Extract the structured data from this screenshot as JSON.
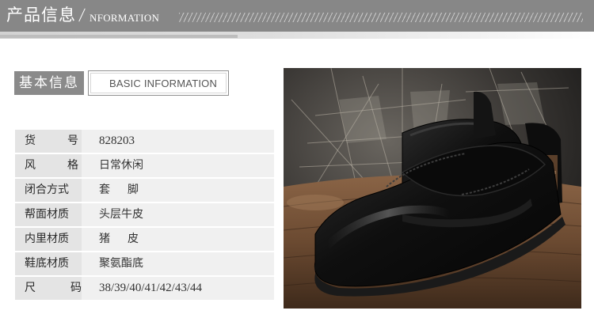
{
  "header": {
    "title_cn": "产品信息",
    "title_en": "NFORMATION"
  },
  "basic": {
    "title_cn": "基本信息",
    "title_en": "BASIC INFORMATION"
  },
  "specs": [
    {
      "label": "货号",
      "value": "828203"
    },
    {
      "label": "风格",
      "value": "日常休闲"
    },
    {
      "label": "闭合方式",
      "value": "套脚"
    },
    {
      "label": "帮面材质",
      "value": "头层牛皮"
    },
    {
      "label": "内里材质",
      "value": "猪皮"
    },
    {
      "label": "鞋底材质",
      "value": "聚氨酯底"
    },
    {
      "label": "尺码",
      "value": "38/39/40/41/42/43/44"
    }
  ],
  "photo": {
    "subject": "black leather slip-on shoes",
    "palette": {
      "leather": "#111111",
      "wood": "#6e4a2f",
      "sky": "#3c3c3c"
    }
  }
}
